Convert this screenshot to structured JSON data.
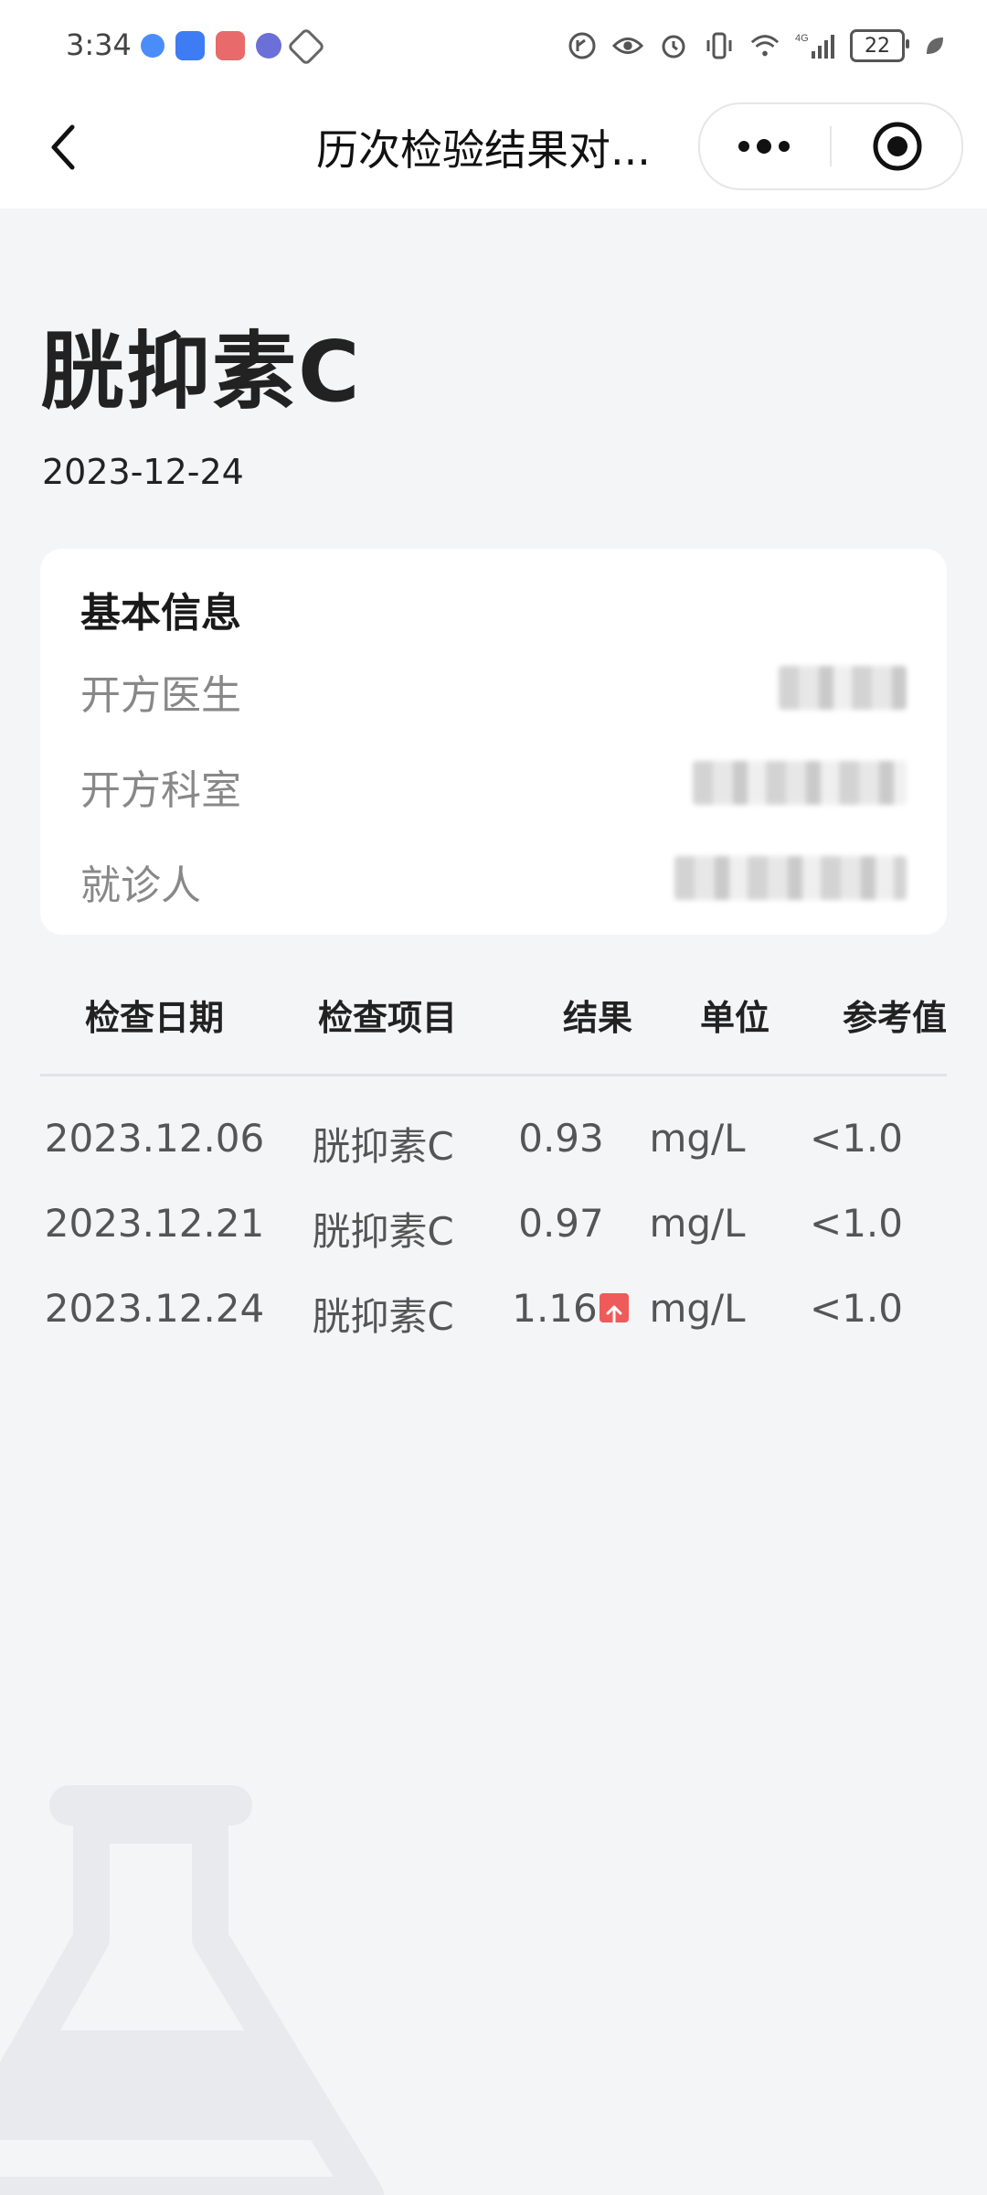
{
  "status_bar": {
    "time": "3:34",
    "battery": "22",
    "network": "4G"
  },
  "nav": {
    "title": "历次检验结果对..."
  },
  "header": {
    "test_name": "胱抑素C",
    "date": "2023-12-24"
  },
  "info_card": {
    "title": "基本信息",
    "rows": [
      {
        "label": "开方医生",
        "value": "▒▒▒▒"
      },
      {
        "label": "开方科室",
        "value": "▒▒▒▒▒▒▒"
      },
      {
        "label": "就诊人",
        "value": "▒▒▒▒ ▒ ▒▒"
      }
    ]
  },
  "table": {
    "headers": [
      "检查日期",
      "检查项目",
      "结果",
      "单位",
      "参考值"
    ],
    "rows": [
      {
        "date": "2023.12.06",
        "item": "胱抑素C",
        "result": "0.93",
        "unit": "mg/L",
        "reference": "<1.0",
        "high": false
      },
      {
        "date": "2023.12.21",
        "item": "胱抑素C",
        "result": "0.97",
        "unit": "mg/L",
        "reference": "<1.0",
        "high": false
      },
      {
        "date": "2023.12.24",
        "item": "胱抑素C",
        "result": "1.16",
        "unit": "mg/L",
        "reference": "<1.0",
        "high": true
      }
    ]
  },
  "icons": {
    "back": "chevron-left-icon",
    "more": "more-dots-icon",
    "close": "target-circle-icon",
    "watermark": "flask-icon",
    "high": "arrow-up-icon"
  },
  "colors": {
    "background": "#f4f5f7",
    "card": "#ffffff",
    "high_badge": "#ef5b5b",
    "text_primary": "#222222",
    "text_secondary": "#888888"
  }
}
